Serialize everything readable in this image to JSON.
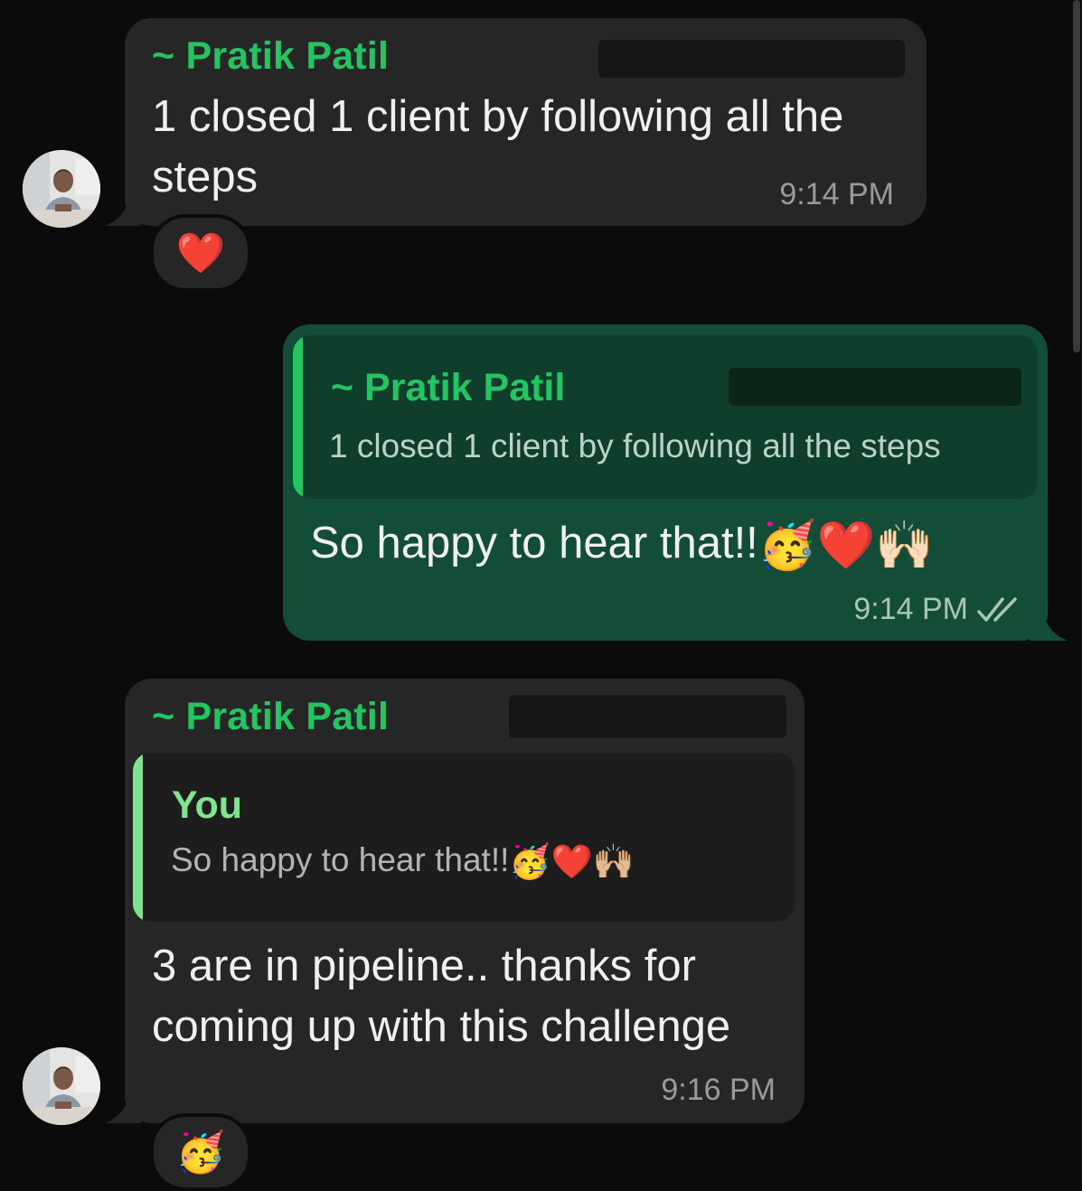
{
  "messages": [
    {
      "sender": "~ Pratik Patil",
      "text_line1": "1 closed 1 client by following all the",
      "text_line2": "steps",
      "time": "9:14 PM",
      "reaction": "❤️"
    },
    {
      "quote_sender": "~ Pratik Patil",
      "quote_text": "1 closed 1 client by following all the steps",
      "text": "So happy to hear that!!",
      "emojis": [
        "🥳",
        "❤️",
        "🙌🏻"
      ],
      "time": "9:14 PM",
      "status_icon": "double-check-icon"
    },
    {
      "sender": "~ Pratik Patil",
      "quote_sender": "You",
      "quote_text": "So happy to hear that!!",
      "quote_emojis": [
        "🥳",
        "❤️",
        "🙌🏼"
      ],
      "text_line1": "3 are in pipeline.. thanks for",
      "text_line2": "coming up with this challenge",
      "time": "9:16 PM",
      "reaction": "🥳"
    }
  ],
  "colors": {
    "background": "#0b0b0b",
    "incoming_bubble": "#262626",
    "outgoing_bubble": "#134d37",
    "sender_name": "#25c463",
    "quote_bar_outgoing": "#25c463",
    "quote_bar_incoming": "#7fe38f"
  }
}
